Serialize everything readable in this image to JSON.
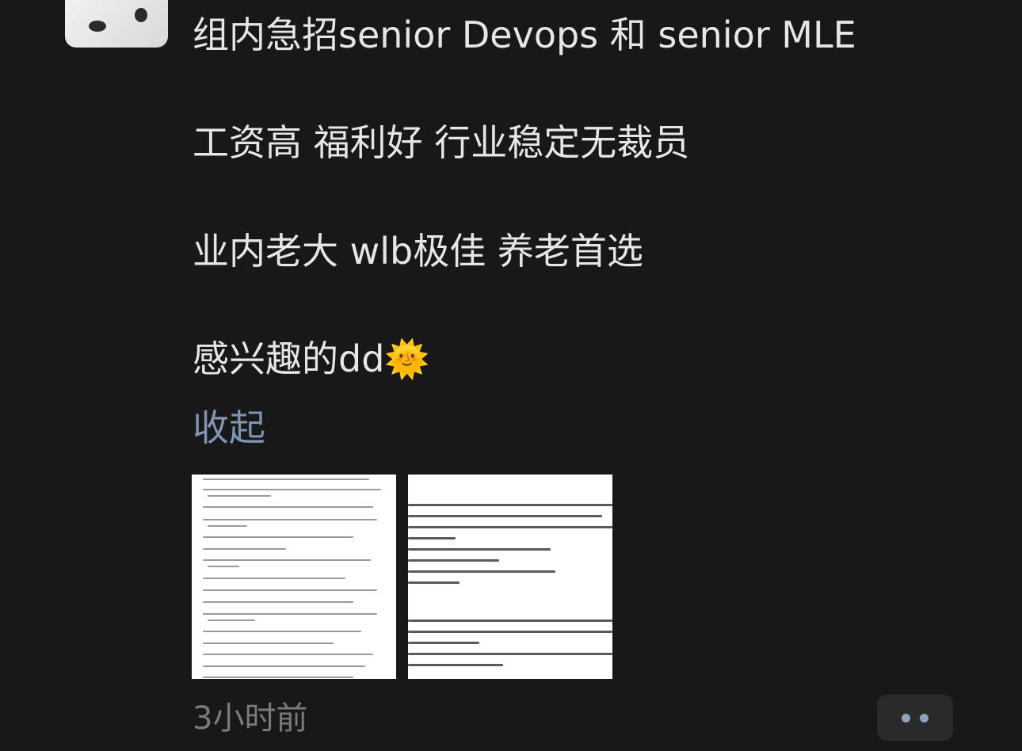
{
  "post": {
    "lines": [
      "组内急招senior Devops 和 senior MLE",
      "工资高 福利好 行业稳定无裁员",
      "业内老大 wlb极佳 养老首选",
      "感兴趣的dd🌞"
    ],
    "collapse_label": "收起",
    "timestamp": "3小时前"
  },
  "images": [
    {
      "icon": "document-thumbnail-icon"
    },
    {
      "icon": "document-thumbnail-icon"
    }
  ],
  "actions": {
    "more_icon": "more-dots-icon"
  },
  "colors": {
    "background": "#181818",
    "text": "#e6e6e6",
    "link": "#7f95b3",
    "muted": "#7a7a7a"
  }
}
